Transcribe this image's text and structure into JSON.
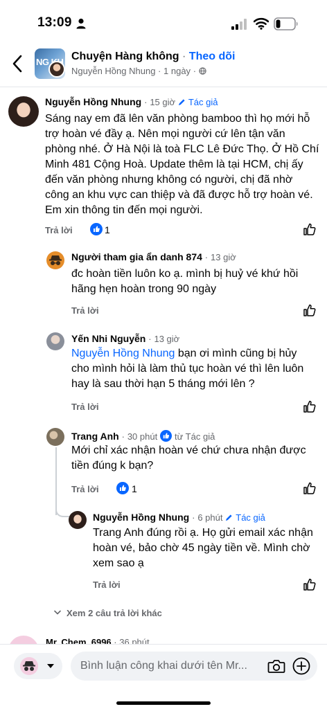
{
  "status_bar": {
    "time": "13:09"
  },
  "header": {
    "group_name": "Chuyện Hàng không",
    "separator": "·",
    "follow_label": "Theo dõi",
    "author": "Nguyễn Hồng Nhung",
    "age": "1 ngày",
    "thumb_text": "NG KH"
  },
  "comments": [
    {
      "author": "Nguyễn Hồng Nhung",
      "time": "15 giờ",
      "tag": "Tác giả",
      "lines": [
        "Sáng nay em đã lên văn phòng bamboo thì họ mới hỗ",
        "trợ hoàn vé đầy ạ. Nên mọi người cứ lên tận văn",
        "phòng nhé. Ở Hà Nội là toà FLC Lê Đức Thọ. Ở Hồ Chí",
        "Minh 481 Cộng Hoà. Update thêm là tại HCM, chị ấy",
        "đến văn phòng nhưng không có người, chị đã nhờ",
        "công an khu vực can thiệp và đã được hỗ trợ hoàn vé.",
        "Em xin thông tin đến mọi người."
      ],
      "reply_label": "Trả lời",
      "likes": "1"
    },
    {
      "author": "Người tham gia ẩn danh 874",
      "time": "13 giờ",
      "lines": [
        "đc hoàn tiền luôn ko ạ. mình bị huỷ vé khứ hồi",
        "hãng hẹn hoàn trong 90 ngày"
      ],
      "reply_label": "Trả lời"
    },
    {
      "author": "Yến Nhi Nguyễn",
      "time": "13 giờ",
      "mention": "Nguyễn Hồng Nhung",
      "lines": [
        " bạn ơi mình cũng bị hủy",
        "cho mình hỏi là làm thủ tục hoàn vé thì lên luôn",
        "hay là sau thời hạn 5 tháng mới lên ?"
      ],
      "reply_label": "Trả lời"
    },
    {
      "author": "Trang Anh",
      "time": "30 phút",
      "tag": "từ Tác giả",
      "lines": [
        "Mới chỉ xác nhận hoàn vé chứ chưa nhận được",
        "tiền đúng k bạn?"
      ],
      "reply_label": "Trả lời",
      "likes": "1"
    },
    {
      "author": "Nguyễn Hồng Nhung",
      "time": "6 phút",
      "tag": "Tác giả",
      "lines": [
        "Trang Anh đúng rồi ạ. Họ gửi email xác nhận",
        "hoàn vé, bảo chờ 45 ngày tiền về. Mình chờ",
        "xem sao ạ"
      ],
      "reply_label": "Trả lời"
    }
  ],
  "more_replies": "Xem 2 câu trả lời khác",
  "next_comment": {
    "author": "Mr. Chem. 6996",
    "time": "36 phút"
  },
  "composer": {
    "placeholder": "Bình luận công khai dưới tên Mr..."
  },
  "colors": {
    "accent": "#0866ff",
    "secondary_text": "#65676b",
    "input_bg": "#f0f2f5"
  }
}
